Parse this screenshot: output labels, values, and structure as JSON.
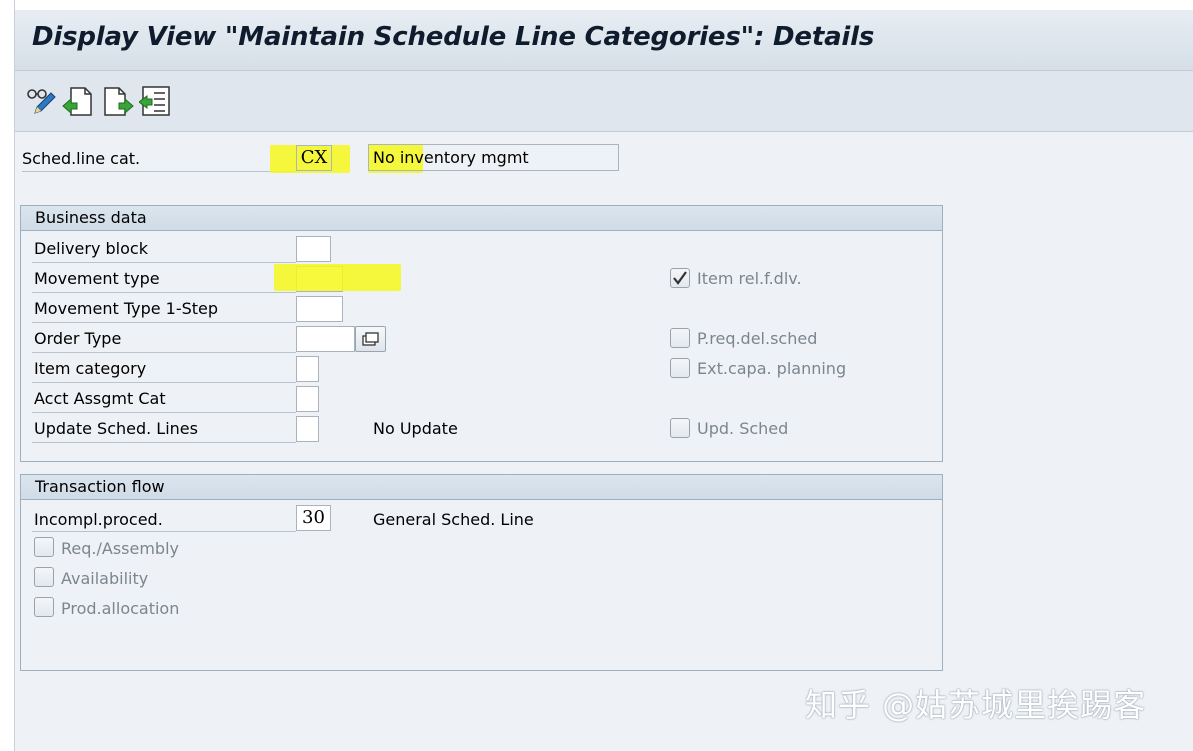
{
  "title": "Display View \"Maintain Schedule Line Categories\": Details",
  "toolbar": {
    "icons": [
      "display-change-icon",
      "previous-entry-icon",
      "next-entry-icon",
      "other-entry-icon"
    ]
  },
  "header_field": {
    "label": "Sched.line cat.",
    "value": "CX",
    "description": "No inventory mgmt"
  },
  "business_data": {
    "title": "Business data",
    "delivery_block": "Delivery block",
    "movement_type": "Movement type",
    "movement_type_1step": "Movement Type 1-Step",
    "order_type": "Order Type",
    "item_category": "Item category",
    "acct_assgmt_cat": "Acct Assgmt Cat",
    "update_sched_lines": "Update Sched. Lines",
    "update_sched_lines_text": "No Update",
    "item_rel_dlv": {
      "label": "Item rel.f.dlv.",
      "checked": true
    },
    "preq_del_sched": {
      "label": "P.req.del.sched",
      "checked": false
    },
    "ext_capa_planning": {
      "label": "Ext.capa. planning",
      "checked": false
    },
    "upd_sched": {
      "label": "Upd. Sched",
      "checked": false
    }
  },
  "transaction_flow": {
    "title": "Transaction flow",
    "incompl_proced": "Incompl.proced.",
    "incompl_value": "30",
    "incompl_text": "General Sched. Line",
    "req_assembly": {
      "label": "Req./Assembly",
      "checked": false
    },
    "availability": {
      "label": "Availability",
      "checked": false
    },
    "prod_allocation": {
      "label": "Prod.allocation",
      "checked": false
    }
  },
  "watermark": "知乎 @姑苏城里挨踢客",
  "colors": {
    "highlight": "#f4f81a",
    "title_text": "#0f1c2e"
  }
}
